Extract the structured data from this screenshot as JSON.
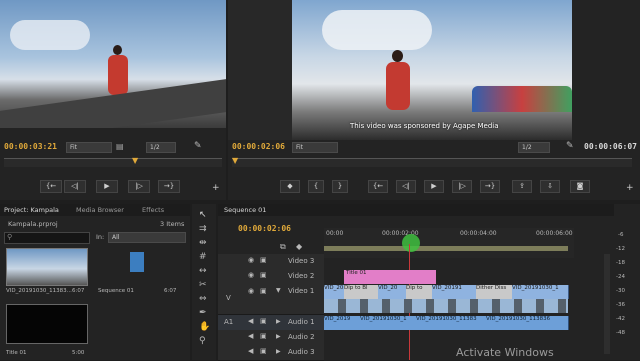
{
  "source_monitor": {
    "timecode": "00:00:03:21",
    "fit": "Fit",
    "resolution": "1/2"
  },
  "program_monitor": {
    "timecode": "00:00:02:06",
    "fit": "Fit",
    "resolution": "1/2",
    "duration": "00:00:06:07",
    "caption": "This video was sponsored by Agape Media"
  },
  "project_panel": {
    "tabs": [
      "Project: Kampala",
      "Media Browser",
      "Effects"
    ],
    "project_file": "Kampala.prproj",
    "items_count": "3 Items",
    "in_label": "In:",
    "in_value": "All",
    "items": [
      {
        "name": "VID_20191030_11383...",
        "duration": "6:07"
      },
      {
        "name": "Sequence 01",
        "duration": "6:07"
      },
      {
        "name": "Title 01",
        "duration": "5:00"
      }
    ]
  },
  "timeline": {
    "tab": "Sequence 01",
    "timecode": "00:00:02:06",
    "ruler": [
      "00:00",
      "00:00:02:00",
      "00:00:04:00",
      "00:00:06:00"
    ],
    "tracks": {
      "video3": "Video 3",
      "video2": "Video 2",
      "video1": "Video 1",
      "audio1": "Audio 1",
      "audio2": "Audio 2",
      "audio3": "Audio 3"
    },
    "v_label": "V",
    "a1_label": "A1",
    "title_clip": "Title 01",
    "video_clips": [
      "VID_20",
      "Dip to Bl",
      "VID_20",
      "Dip to",
      "VID_20191",
      "Dither Diss",
      "VID_20191030_1"
    ],
    "audio_clips": [
      "VID_2019",
      "VID_20191030_1",
      "VID_20191030_11383",
      "VID_20191030_113836"
    ]
  },
  "meter_scale": [
    "-6",
    "-12",
    "-18",
    "-24",
    "-30",
    "-36",
    "-42",
    "-48"
  ],
  "watermark": "Activate Windows"
}
